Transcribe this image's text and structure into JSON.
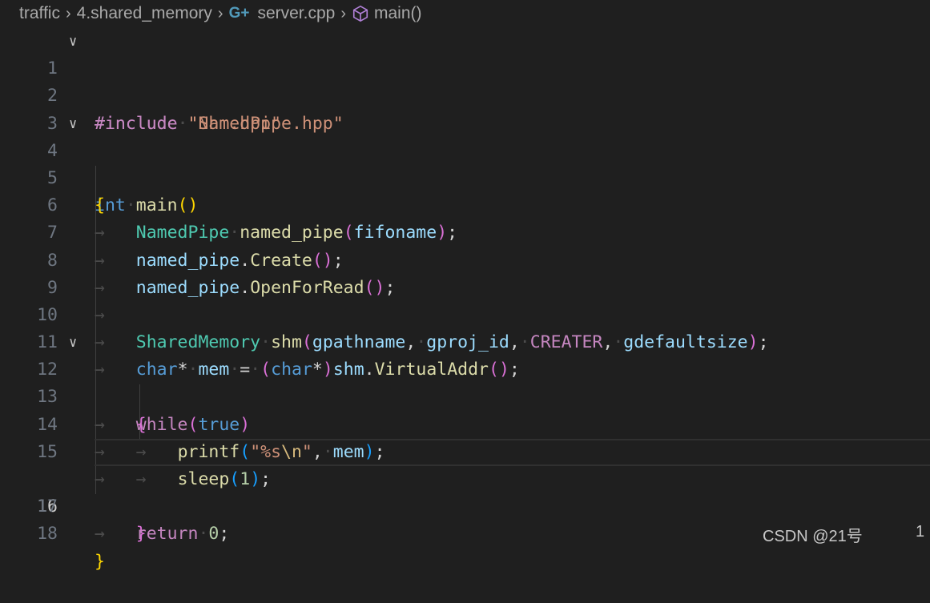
{
  "breadcrumb": {
    "folder": "traffic",
    "subfolder": "4.shared_memory",
    "file": "server.cpp",
    "symbol": "main()",
    "file_icon": "cpp-icon",
    "symbol_icon": "cube-icon"
  },
  "editor": {
    "lines": [
      {
        "n": "1"
      },
      {
        "n": "2"
      },
      {
        "n": "3"
      },
      {
        "n": "4"
      },
      {
        "n": "5"
      },
      {
        "n": "6"
      },
      {
        "n": "7"
      },
      {
        "n": "8"
      },
      {
        "n": "9"
      },
      {
        "n": "10"
      },
      {
        "n": "11"
      },
      {
        "n": "12"
      },
      {
        "n": "13"
      },
      {
        "n": "14"
      },
      {
        "n": "15"
      },
      {
        "n": "16"
      },
      {
        "n": "17"
      },
      {
        "n": "18"
      }
    ],
    "tokens": {
      "l1_inc": "#include",
      "l1_str": "\"Shm.hpp\"",
      "l2_inc": "#include",
      "l2_str": "\"NamedPipe.hpp\"",
      "l4_type": "int",
      "l4_fn": "main",
      "l6_cls": "NamedPipe",
      "l6_var": "named_pipe",
      "l6_arg": "fifoname",
      "l7_obj": "named_pipe",
      "l7_fn": "Create",
      "l8_obj": "named_pipe",
      "l8_fn": "OpenForRead",
      "l10_cls": "SharedMemory",
      "l10_var": "shm",
      "l10_a1": "gpathname",
      "l10_a2": "gproj_id",
      "l10_a3": "CREATER",
      "l10_a4": "gdefaultsize",
      "l11_type": "char",
      "l11_var": "mem",
      "l11_type2": "char",
      "l11_obj": "shm",
      "l11_fn": "VirtualAddr",
      "l12_kw": "while",
      "l12_val": "true",
      "l14_fn": "printf",
      "l14_str_a": "\"%s",
      "l14_esc": "\\n",
      "l14_str_b": "\"",
      "l14_var": "mem",
      "l15_fn": "sleep",
      "l15_num": "1",
      "l17_kw": "return",
      "l17_num": "0"
    }
  },
  "watermark": {
    "text": "CSDN @21号",
    "extra": "1"
  }
}
